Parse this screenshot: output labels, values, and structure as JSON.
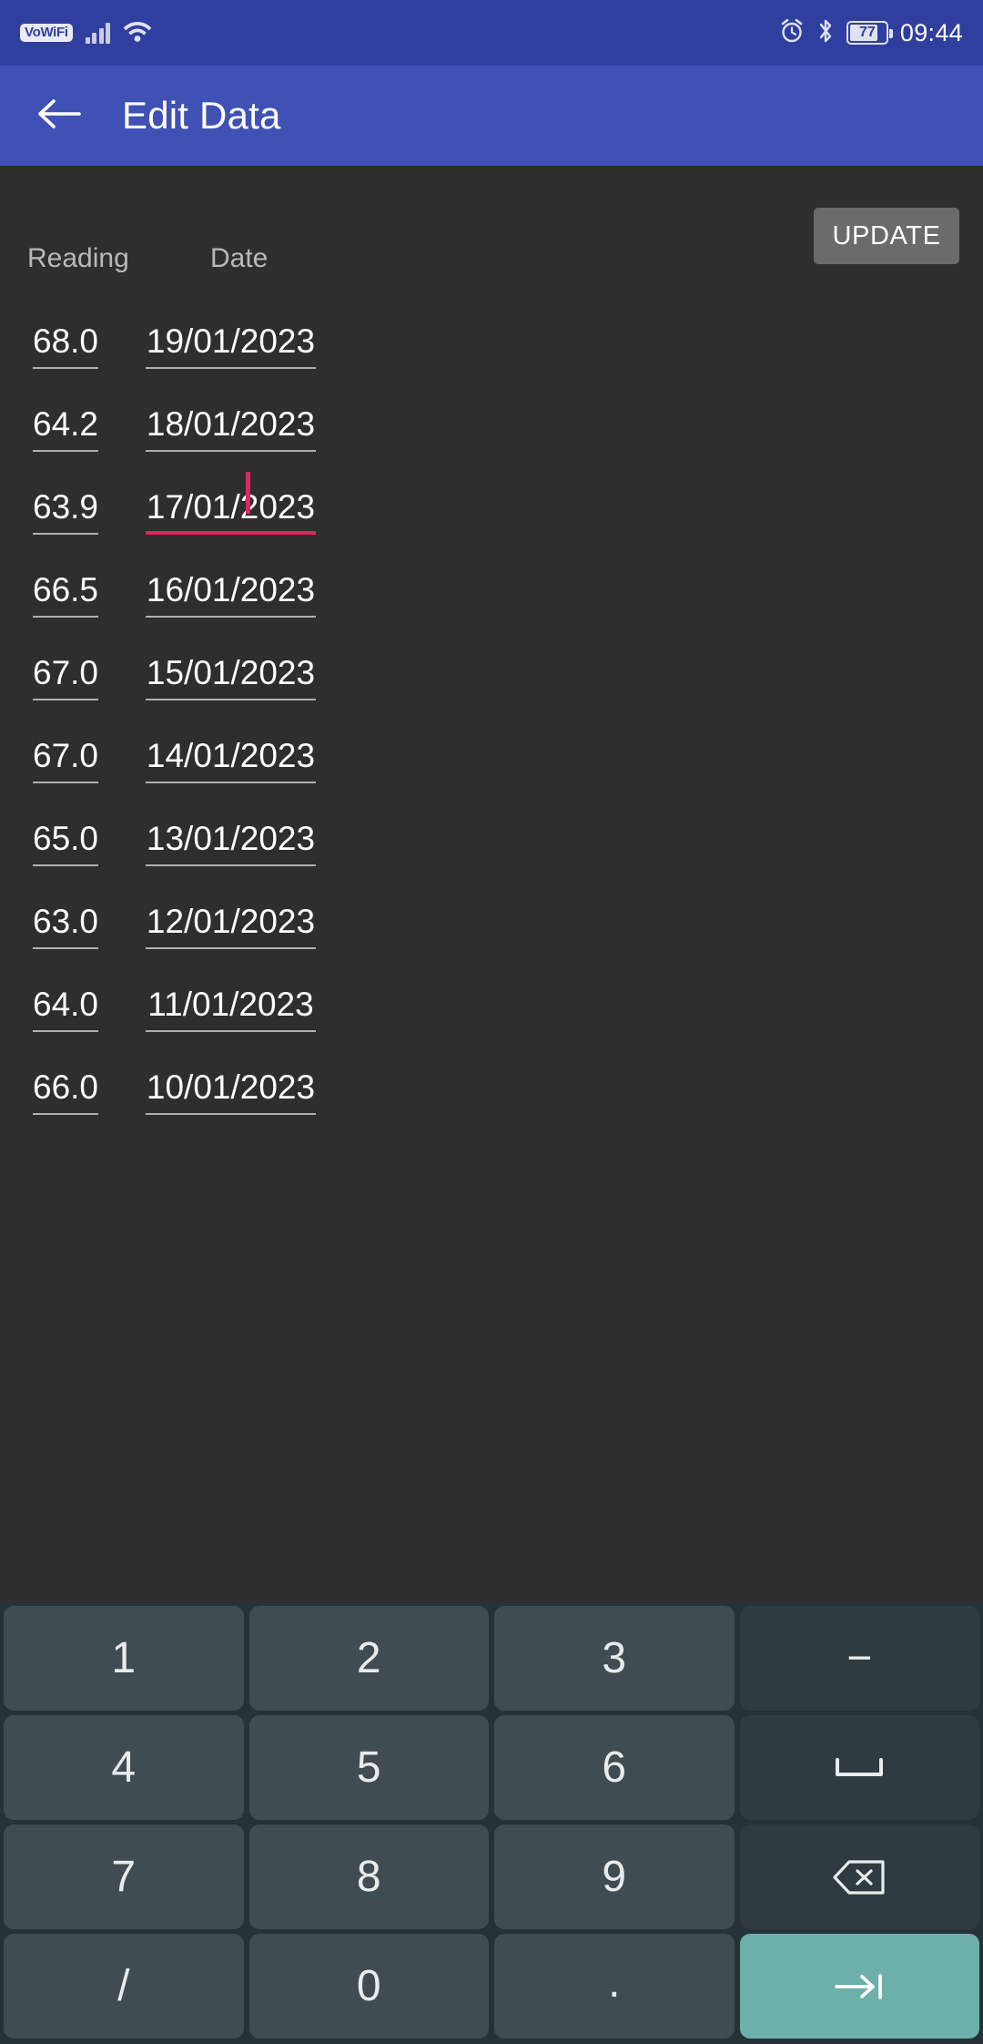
{
  "status_bar": {
    "vowifi_label": "VoWiFi",
    "signal_icon": "cellular-signal-icon",
    "wifi_icon": "wifi-icon",
    "alarm_icon": "alarm-clock-icon",
    "bluetooth_icon": "bluetooth-icon",
    "battery_level": "77",
    "time": "09:44",
    "background_color": "#303f9f"
  },
  "app_bar": {
    "back_icon": "arrow-left-icon",
    "title": "Edit Data",
    "background_color": "#4051b5"
  },
  "toolbar": {
    "update_label": "UPDATE"
  },
  "table": {
    "columns": [
      "Reading",
      "Date"
    ],
    "rows": [
      {
        "reading": "68.0",
        "date": "19/01/2023",
        "focused": false
      },
      {
        "reading": "64.2",
        "date": "18/01/2023",
        "focused": false
      },
      {
        "reading": "63.9",
        "date": "17/01/2023",
        "focused": true
      },
      {
        "reading": "66.5",
        "date": "16/01/2023",
        "focused": false
      },
      {
        "reading": "67.0",
        "date": "15/01/2023",
        "focused": false
      },
      {
        "reading": "67.0",
        "date": "14/01/2023",
        "focused": false
      },
      {
        "reading": "65.0",
        "date": "13/01/2023",
        "focused": false
      },
      {
        "reading": "63.0",
        "date": "12/01/2023",
        "focused": false
      },
      {
        "reading": "64.0",
        "date": "11/01/2023",
        "focused": false
      },
      {
        "reading": "66.0",
        "date": "10/01/2023",
        "focused": false
      }
    ],
    "focus_color": "#e0255f",
    "underline_color": "#b0b0b0"
  },
  "keyboard": {
    "background_color": "#263238",
    "key_color": "#414c52",
    "special_key_color": "#2f3b40",
    "accent_key_color": "#6cafab",
    "rows": [
      [
        {
          "label": "1",
          "name": "key-1",
          "type": "digit"
        },
        {
          "label": "2",
          "name": "key-2",
          "type": "digit"
        },
        {
          "label": "3",
          "name": "key-3",
          "type": "digit"
        },
        {
          "label": "−",
          "name": "key-minus",
          "type": "special"
        }
      ],
      [
        {
          "label": "4",
          "name": "key-4",
          "type": "digit"
        },
        {
          "label": "5",
          "name": "key-5",
          "type": "digit"
        },
        {
          "label": "6",
          "name": "key-6",
          "type": "digit"
        },
        {
          "label": "⌴",
          "name": "key-space",
          "type": "special-icon",
          "icon": "space-bar-icon"
        }
      ],
      [
        {
          "label": "7",
          "name": "key-7",
          "type": "digit"
        },
        {
          "label": "8",
          "name": "key-8",
          "type": "digit"
        },
        {
          "label": "9",
          "name": "key-9",
          "type": "digit"
        },
        {
          "label": "",
          "name": "key-backspace",
          "type": "special-icon",
          "icon": "backspace-icon"
        }
      ],
      [
        {
          "label": "/",
          "name": "key-slash",
          "type": "digit"
        },
        {
          "label": "0",
          "name": "key-0",
          "type": "digit"
        },
        {
          "label": ".",
          "name": "key-period",
          "type": "digit"
        },
        {
          "label": "",
          "name": "key-next",
          "type": "accent-icon",
          "icon": "tab-next-icon"
        }
      ]
    ]
  }
}
